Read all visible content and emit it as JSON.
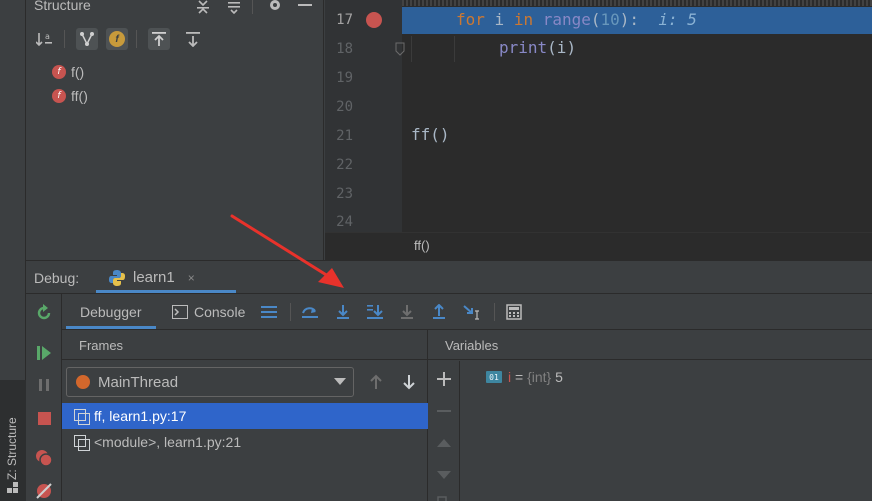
{
  "structure": {
    "title": "Structure",
    "items": [
      {
        "label": "f()",
        "badge": "f"
      },
      {
        "label": "ff()",
        "badge": "f"
      }
    ],
    "sort_badge": "a",
    "field_badge": "f"
  },
  "left_strip": {
    "structure_label": "Z: Structure"
  },
  "editor": {
    "lines": [
      {
        "num": "17",
        "has_breakpoint": true
      },
      {
        "num": "18"
      },
      {
        "num": "19"
      },
      {
        "num": "20"
      },
      {
        "num": "21"
      },
      {
        "num": "22"
      },
      {
        "num": "23"
      },
      {
        "num": "24"
      }
    ],
    "code": {
      "l17_kw_for": "for",
      "l17_var": " i ",
      "l17_kw_in": "in",
      "l17_space": " ",
      "l17_builtin": "range",
      "l17_open": "(",
      "l17_num": "10",
      "l17_close": "):",
      "l17_inline": "i: 5",
      "l18_builtin": "print",
      "l18_rest": "(i)",
      "l21": "ff()"
    },
    "breadcrumb": "ff()"
  },
  "debug": {
    "label": "Debug:",
    "session_tab": "learn1",
    "close_glyph": "×",
    "subtabs": {
      "debugger": "Debugger",
      "console": "Console"
    },
    "frames": {
      "title": "Frames",
      "thread": "MainThread",
      "rows": [
        "ff, learn1.py:17",
        "<module>, learn1.py:21"
      ]
    },
    "variables": {
      "title": "Variables",
      "badge": "01",
      "name": "i",
      "equals": " = ",
      "type": "{int}",
      "value": " 5"
    }
  },
  "colors": {
    "accent": "#4a88c7",
    "selection": "#2f65ca",
    "exec_line": "#2d6099",
    "breakpoint": "#c75450",
    "annotation": "#e8322b"
  }
}
